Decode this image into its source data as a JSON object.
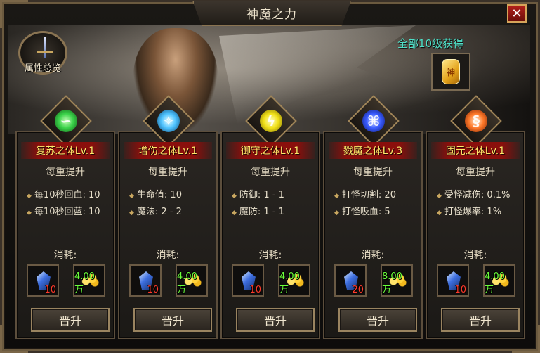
{
  "window": {
    "title": "神魔之力",
    "close_symbol": "✕"
  },
  "overview": {
    "label": "属性总览"
  },
  "reward": {
    "label": "全部10级获得",
    "token_text": "神"
  },
  "common": {
    "upgrade_label": "每重提升",
    "cost_label": "消耗:",
    "promote_label": "晋升"
  },
  "cards": [
    {
      "name": "复苏之体Lv.1",
      "gem_color": "#3bd24a",
      "stats": [
        "每10秒回血: 10",
        "每10秒回蓝: 10"
      ],
      "cost_crystal": "10",
      "cost_gold": "4.00万"
    },
    {
      "name": "增伤之体Lv.1",
      "gem_color": "#4ec3ff",
      "stats": [
        "生命值: 10",
        "魔法: 2 - 2"
      ],
      "cost_crystal": "10",
      "cost_gold": "4.00万"
    },
    {
      "name": "御守之体Lv.1",
      "gem_color": "#f2e21a",
      "stats": [
        "防御: 1 - 1",
        "魔防: 1 - 1"
      ],
      "cost_crystal": "10",
      "cost_gold": "4.00万"
    },
    {
      "name": "戮魔之体Lv.3",
      "gem_color": "#3a5cff",
      "stats": [
        "打怪切割: 20",
        "打怪吸血: 5"
      ],
      "cost_crystal": "20",
      "cost_gold": "8.00万"
    },
    {
      "name": "固元之体Lv.1",
      "gem_color": "#ff7a2a",
      "stats": [
        "受怪减伤: 0.1%",
        "打怪爆率: 1%"
      ],
      "cost_crystal": "10",
      "cost_gold": "4.00万"
    }
  ]
}
